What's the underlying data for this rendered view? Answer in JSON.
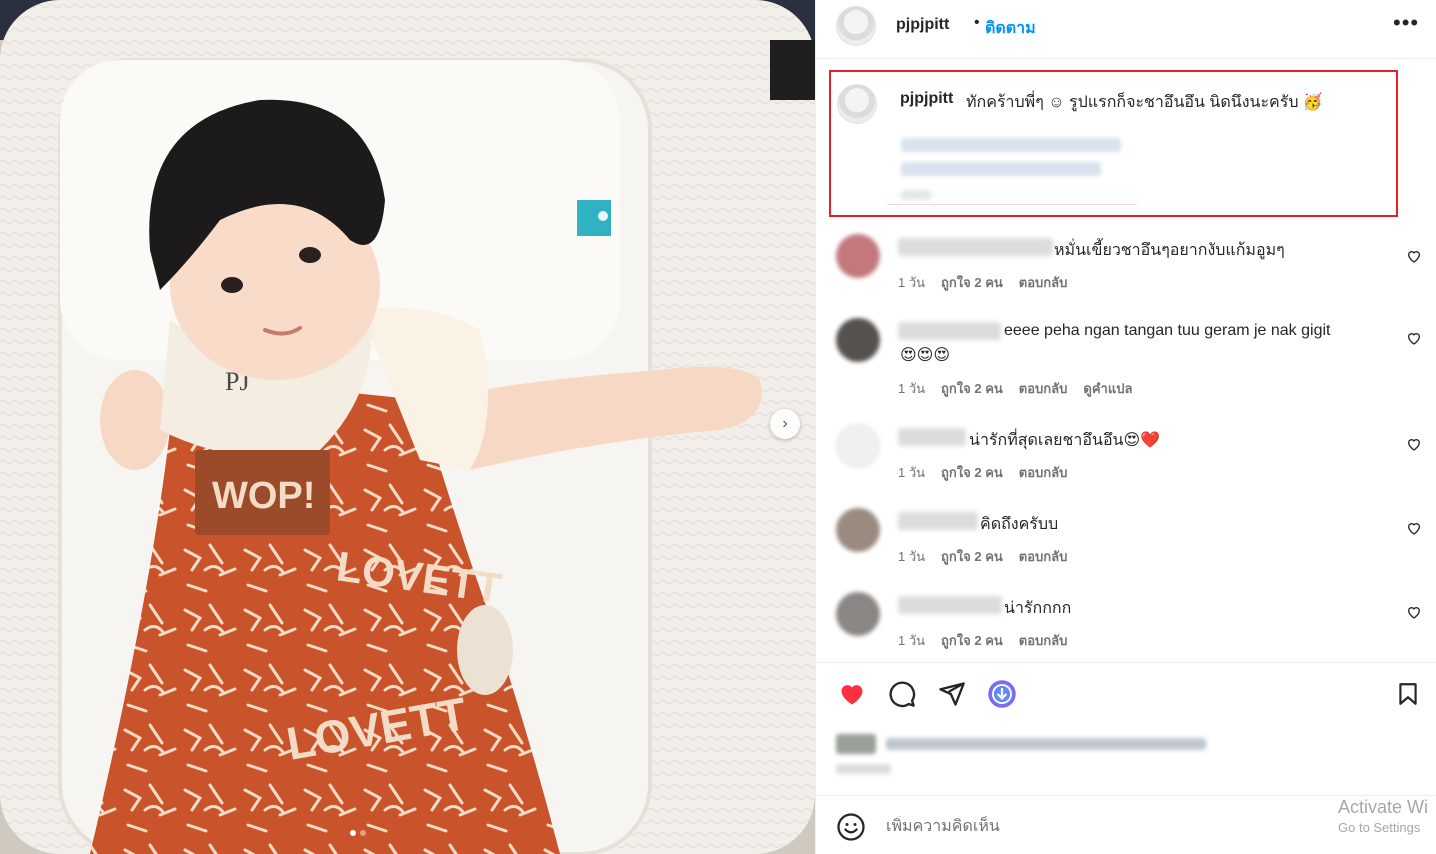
{
  "post": {
    "username": "pjpjpitt",
    "dot": "•",
    "follow": "ติดตาม",
    "more": "•••"
  },
  "caption": {
    "username": "pjpjpitt",
    "text": "ทักคร้าบพี่ๆ ☺︎ รูปแรกก็จะชาอึนอึน นิดนึงนะครับ 🥳"
  },
  "comments": [
    {
      "text": "หมั่นเขี้ยวชาอึนๆอยากงับแก้มอูมๆ",
      "time": "1 วัน",
      "likes": "ถูกใจ 2 คน",
      "reply": "ตอบกลับ",
      "translate": ""
    },
    {
      "text": "eeee peha ngan tangan tuu geram je nak gigit",
      "text2": "😍😍😍",
      "time": "1 วัน",
      "likes": "ถูกใจ 2 คน",
      "reply": "ตอบกลับ",
      "translate": "ดูคำแปล"
    },
    {
      "text": "น่ารักที่สุดเลยชาอึนอึน😍❤️",
      "time": "1 วัน",
      "likes": "ถูกใจ 2 คน",
      "reply": "ตอบกลับ",
      "translate": ""
    },
    {
      "text": "คิดถึงครับบ",
      "time": "1 วัน",
      "likes": "ถูกใจ 2 คน",
      "reply": "ตอบกลับ",
      "translate": ""
    },
    {
      "text": "น่ารักกกก",
      "time": "1 วัน",
      "likes": "ถูกใจ 2 คน",
      "reply": "ตอบกลับ",
      "translate": ""
    }
  ],
  "photo": {
    "bib_text": "PJ",
    "pocket_text": "WOP!",
    "brand_text": "LOVETT"
  },
  "input": {
    "placeholder": "เพิ่มความคิดเห็น"
  },
  "watermark": {
    "line1": "Activate Wi",
    "line2": "Go to Settings"
  },
  "icons": {
    "like": "heart-filled-icon",
    "comment": "comment-bubble-icon",
    "share": "paper-plane-icon",
    "download": "download-circle-icon",
    "save": "bookmark-icon",
    "emoji": "smiley-icon",
    "next": "chevron-right-icon"
  },
  "colors": {
    "like_red": "#ff3040",
    "follow_blue": "#0095f6",
    "highlight_box": "#e5202a",
    "download_purple": "#7b6cf6"
  }
}
